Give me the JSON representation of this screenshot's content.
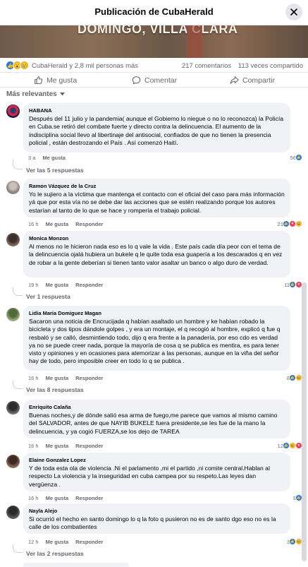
{
  "header": {
    "title": "Publicación de CubaHerald",
    "close_icon": "close-icon"
  },
  "hero": {
    "caption": "DOMINGO, VILLA CLARA"
  },
  "stats": {
    "reaction_icons": [
      "like-icon",
      "wow-icon",
      "sad-icon"
    ],
    "who": "CubaHerald y 2,8 mil personas más",
    "comments": "217 comentarios",
    "shares": "113 veces compartido"
  },
  "actions": {
    "like": "Me gusta",
    "comment": "Comentar",
    "share": "Compartir"
  },
  "sort_label": "Más relevantes",
  "comments": [
    {
      "name": "HABANA",
      "text": "Después del 11 julio y la pandemia( aunque el Gobierno lo niegue o no lo reconozca) la Policía en Cuba.se retiró del combate fuerte y directo contra la delincuencia. El aumento de la indisciplina social llevo al libertinaje del antisocial, confiados de que no tienen la presencia policial , están destrozando el País . Así comenzó Haití.",
      "time": "3 a",
      "like": "Me gusta",
      "reply": "",
      "count": "56",
      "replies": "Ver las 5 respuestas"
    },
    {
      "name": "Ramon Vázquez de la Cruz",
      "text": "Yo le sujiero a la víctima que mantenga el contacto con el oficial del caso para más información yá que por esta vía no se debe dar las acciones que se estén realizando porque los autores estarían al tanto de lo que se hace y rompería el trabajo policial.",
      "time": "16 h",
      "like": "Me gusta",
      "reply": "Responder",
      "count": "21",
      "replies": ""
    },
    {
      "name": "Monica Monzon",
      "text": "Al menos no le hicieron nada eso es lo q vale la vida . Este país cada día peor con el tema de la delincuencia ojalá hubiera un bukele q le quite toda esa guapería a los descarados q en vez de robar a la gente deberían si tienen tanto valor asaltar un banco o algo duro de verdad.",
      "time": "19 h",
      "like": "Me gusta",
      "reply": "Responder",
      "count": "11",
      "replies": "Ver 1 respuesta"
    },
    {
      "name": "Lidia Maria Domiguez Magan",
      "text": "Sacaron una noticia de Encrucijada q habían asaltado un hombre y ke habían robado la bicicleta y dos tipos dándole golpes , y era un montaje, el q recogió al hombre, explicó q fue q resbaló y se calló, desmintiendo todo, dijo q era frente a la panadería, por eso cdo es verdad ya no se puede creer nada, porque la mayoría de cosa q se publica es mentira, es para tener visto y opiniones y en ocasiones para atemorizar a las personas, aunque en la viña del señor hay de todo, pero imposible creer en todo lo q se publica .",
      "time": "16 h",
      "like": "Me gusta",
      "reply": "Responder",
      "count": "8",
      "replies": "Ver las 8 respuestas"
    },
    {
      "name": "Enriquito Calaña",
      "text": "Buenas noches,y de dónde salió esa arma de fuego,me parece que vamos al mismo camino del SALVADOR, antes de que NAYIB BUKELE fuera presidente,se les fue de la mano la delincuencia, y ya cogió FUERZA,se los dejo de TAREA",
      "time": "16 h",
      "like": "Me gusta",
      "reply": "Responder",
      "count": "12",
      "replies": ""
    },
    {
      "name": "Elaine Gonzalez Lopez",
      "text": "Y de toda esta ola de violencia .Ni el parlamento ,mi el partido ,ni comite central.Hablan al respecto La violencia y la inseguridad en cuba campea por su respeto.Las leyes dan vergüenza .",
      "time": "16 h",
      "like": "Me gusta",
      "reply": "Responder",
      "count": "9",
      "replies": ""
    },
    {
      "name": "Nayla Alejo",
      "text": "Si ocurrió el hecho en santo domingo lo q la foto q pusieron no es de santo dgo eso no es la calle de los combatientes",
      "time": "12 h",
      "like": "Me gusta",
      "reply": "Responder",
      "count": "3",
      "replies": "Ver las 2 respuestas"
    }
  ]
}
